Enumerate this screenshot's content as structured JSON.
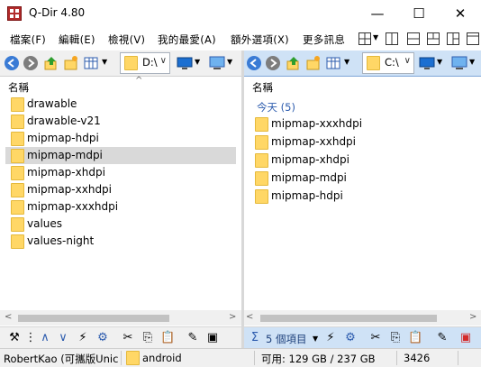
{
  "window": {
    "title": "Q-Dir 4.80",
    "minimize": "—",
    "maximize": "☐",
    "close": "✕"
  },
  "menu": {
    "items": [
      "檔案(F)",
      "編輯(E)",
      "檢視(V)",
      "我的最愛(A)",
      "額外選項(X)",
      "更多訊息"
    ]
  },
  "left_pane": {
    "drive": "D:\\",
    "column_header": "名稱",
    "items": [
      "drawable",
      "drawable-v21",
      "mipmap-hdpi",
      "mipmap-mdpi",
      "mipmap-xhdpi",
      "mipmap-xxhdpi",
      "mipmap-xxxhdpi",
      "values",
      "values-night"
    ],
    "selected_index": 3
  },
  "right_pane": {
    "drive": "C:\\",
    "column_header": "名稱",
    "group_label": "今天 (5)",
    "items": [
      "mipmap-xxxhdpi",
      "mipmap-xxhdpi",
      "mipmap-xhdpi",
      "mipmap-mdpi",
      "mipmap-hdpi"
    ],
    "item_count_label": "5 個項目"
  },
  "statusbar": {
    "user": "RobertKao (可攜版Unic",
    "folder": "android",
    "free_space": "可用: 129 GB / 237 GB",
    "count": "3426"
  },
  "colors": {
    "accent": "#cfe2f6",
    "folder": "#ffd766",
    "close_red": "#d42b2b"
  }
}
